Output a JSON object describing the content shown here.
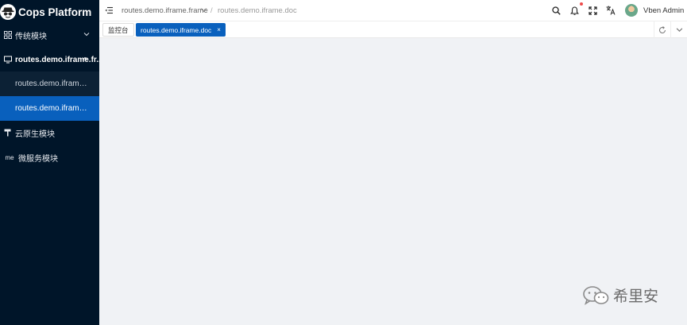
{
  "app": {
    "title": "Cops Platform"
  },
  "sidebar": {
    "items": [
      {
        "label": "传统模块",
        "icon": "grid-icon"
      },
      {
        "label": "routes.demo.iframe.fr...",
        "icon": "monitor-icon"
      },
      {
        "label": "云原生模块",
        "icon": "paint-roller-icon"
      },
      {
        "label": "微服务模块",
        "icon_text": "me"
      }
    ],
    "submenu": [
      {
        "label": "routes.demo.iframe.doc"
      },
      {
        "label": "routes.demo.iframe.d..."
      }
    ]
  },
  "header": {
    "breadcrumb": [
      {
        "label": "routes.demo.iframe.frame"
      },
      {
        "label": "/"
      },
      {
        "label": "routes.demo.iframe.doc"
      }
    ],
    "user": {
      "name": "Vben Admin"
    }
  },
  "tabs": [
    {
      "label": "监控台"
    },
    {
      "label": "routes.demo.iframe.doc",
      "close": "×"
    }
  ],
  "watermark": {
    "text": "希里安"
  },
  "colors": {
    "sidebar_bg": "#001529",
    "accent": "#0960bd",
    "notify_dot": "#ed4b4b"
  }
}
